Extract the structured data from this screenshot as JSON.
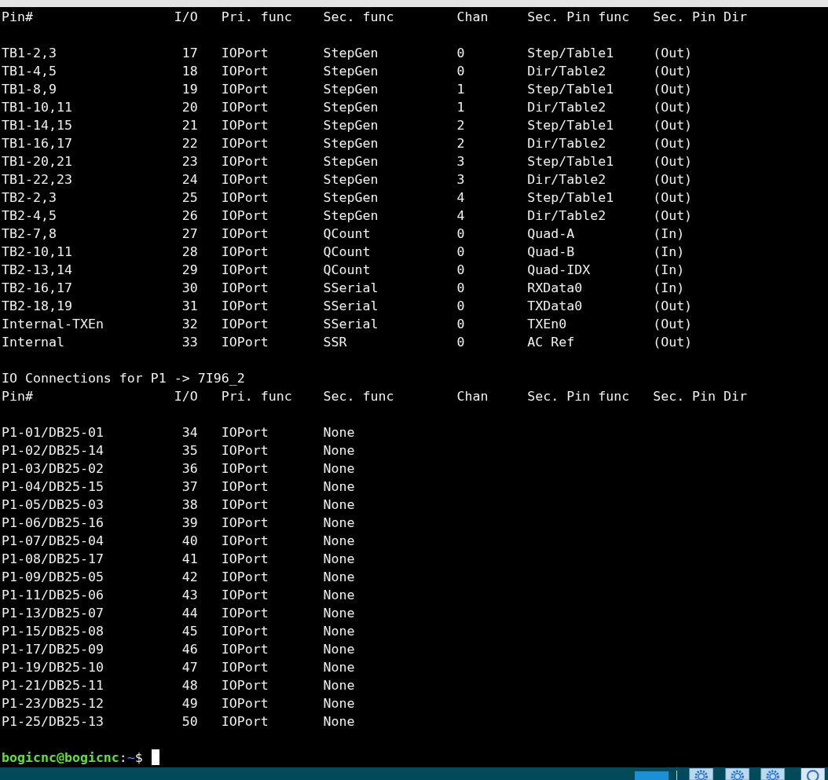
{
  "terminal": {
    "sections": [
      {
        "columns": [
          "Pin#",
          "I/O",
          "Pri. func",
          "Sec. func",
          "Chan",
          "Sec. Pin func",
          "Sec. Pin Dir"
        ],
        "rows": [
          [
            "TB1-2,3",
            "17",
            "IOPort",
            "StepGen",
            "0",
            "Step/Table1",
            "(Out)"
          ],
          [
            "TB1-4,5",
            "18",
            "IOPort",
            "StepGen",
            "0",
            "Dir/Table2",
            "(Out)"
          ],
          [
            "TB1-8,9",
            "19",
            "IOPort",
            "StepGen",
            "1",
            "Step/Table1",
            "(Out)"
          ],
          [
            "TB1-10,11",
            "20",
            "IOPort",
            "StepGen",
            "1",
            "Dir/Table2",
            "(Out)"
          ],
          [
            "TB1-14,15",
            "21",
            "IOPort",
            "StepGen",
            "2",
            "Step/Table1",
            "(Out)"
          ],
          [
            "TB1-16,17",
            "22",
            "IOPort",
            "StepGen",
            "2",
            "Dir/Table2",
            "(Out)"
          ],
          [
            "TB1-20,21",
            "23",
            "IOPort",
            "StepGen",
            "3",
            "Step/Table1",
            "(Out)"
          ],
          [
            "TB1-22,23",
            "24",
            "IOPort",
            "StepGen",
            "3",
            "Dir/Table2",
            "(Out)"
          ],
          [
            "TB2-2,3",
            "25",
            "IOPort",
            "StepGen",
            "4",
            "Step/Table1",
            "(Out)"
          ],
          [
            "TB2-4,5",
            "26",
            "IOPort",
            "StepGen",
            "4",
            "Dir/Table2",
            "(Out)"
          ],
          [
            "TB2-7,8",
            "27",
            "IOPort",
            "QCount",
            "0",
            "Quad-A",
            "(In)"
          ],
          [
            "TB2-10,11",
            "28",
            "IOPort",
            "QCount",
            "0",
            "Quad-B",
            "(In)"
          ],
          [
            "TB2-13,14",
            "29",
            "IOPort",
            "QCount",
            "0",
            "Quad-IDX",
            "(In)"
          ],
          [
            "TB2-16,17",
            "30",
            "IOPort",
            "SSerial",
            "0",
            "RXData0",
            "(In)"
          ],
          [
            "TB2-18,19",
            "31",
            "IOPort",
            "SSerial",
            "0",
            "TXData0",
            "(Out)"
          ],
          [
            "Internal-TXEn",
            "32",
            "IOPort",
            "SSerial",
            "0",
            "TXEn0",
            "(Out)"
          ],
          [
            "Internal",
            "33",
            "IOPort",
            "SSR",
            "0",
            "AC Ref",
            "(Out)"
          ]
        ]
      },
      {
        "title": "IO Connections for P1 -> 7I96_2",
        "columns": [
          "Pin#",
          "I/O",
          "Pri. func",
          "Sec. func",
          "Chan",
          "Sec. Pin func",
          "Sec. Pin Dir"
        ],
        "rows": [
          [
            "P1-01/DB25-01",
            "34",
            "IOPort",
            "None"
          ],
          [
            "P1-02/DB25-14",
            "35",
            "IOPort",
            "None"
          ],
          [
            "P1-03/DB25-02",
            "36",
            "IOPort",
            "None"
          ],
          [
            "P1-04/DB25-15",
            "37",
            "IOPort",
            "None"
          ],
          [
            "P1-05/DB25-03",
            "38",
            "IOPort",
            "None"
          ],
          [
            "P1-06/DB25-16",
            "39",
            "IOPort",
            "None"
          ],
          [
            "P1-07/DB25-04",
            "40",
            "IOPort",
            "None"
          ],
          [
            "P1-08/DB25-17",
            "41",
            "IOPort",
            "None"
          ],
          [
            "P1-09/DB25-05",
            "42",
            "IOPort",
            "None"
          ],
          [
            "P1-11/DB25-06",
            "43",
            "IOPort",
            "None"
          ],
          [
            "P1-13/DB25-07",
            "44",
            "IOPort",
            "None"
          ],
          [
            "P1-15/DB25-08",
            "45",
            "IOPort",
            "None"
          ],
          [
            "P1-17/DB25-09",
            "46",
            "IOPort",
            "None"
          ],
          [
            "P1-19/DB25-10",
            "47",
            "IOPort",
            "None"
          ],
          [
            "P1-21/DB25-11",
            "48",
            "IOPort",
            "None"
          ],
          [
            "P1-23/DB25-12",
            "49",
            "IOPort",
            "None"
          ],
          [
            "P1-25/DB25-13",
            "50",
            "IOPort",
            "None"
          ]
        ]
      }
    ],
    "prompt": {
      "user_host": "bogicnc@bogicnc",
      "separator": ":",
      "path": "~",
      "symbol": "$"
    }
  }
}
